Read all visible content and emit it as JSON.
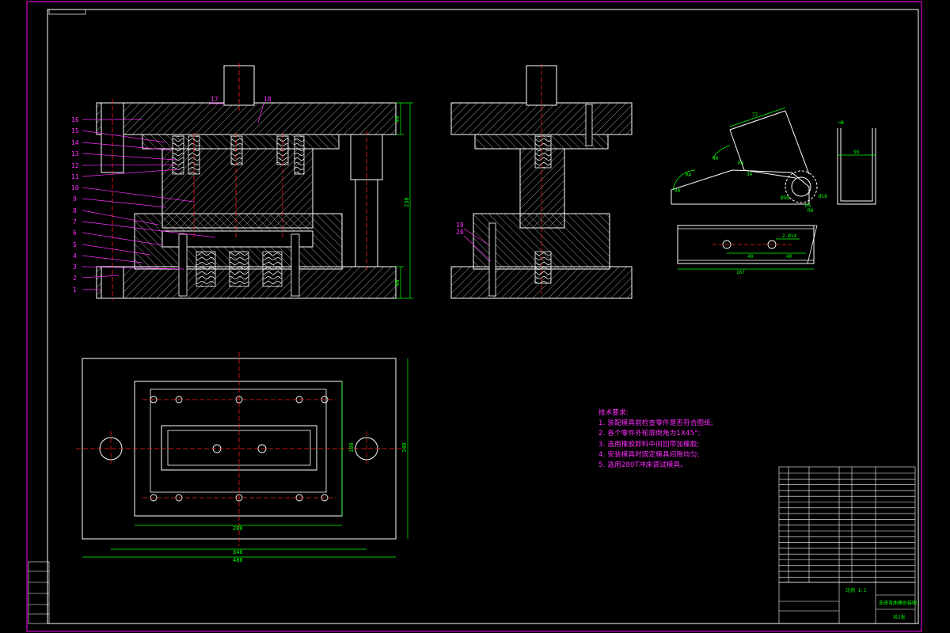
{
  "part_labels_left": [
    "16",
    "15",
    "14",
    "13",
    "12",
    "11",
    "10",
    "9",
    "8",
    "7",
    "6",
    "5",
    "4",
    "3",
    "2",
    "1"
  ],
  "top_labels": [
    "17",
    "18"
  ],
  "side_labels": [
    "19",
    "20"
  ],
  "dims_front": {
    "top": "40",
    "total": "238",
    "bottom": "40"
  },
  "dims_part": {
    "d1": "77",
    "d2": "40",
    "d3": "R4",
    "d4": "90",
    "d5": "34",
    "d6": "R4",
    "d7": "Ø18",
    "d8": "Ø50",
    "d9": "R5",
    "d10": "R8"
  },
  "dims_u": {
    "top": "R",
    "inner": "56"
  },
  "dims_flat": {
    "hole": "2-Ø14",
    "a": "40",
    "b": "40",
    "len": "167"
  },
  "dims_plan": {
    "w1": "280",
    "w2": "340",
    "w3": "480",
    "h1": "180",
    "h2": "340"
  },
  "tech_notes": {
    "title": "技术要求:",
    "lines": [
      "1. 装配模具前检查零件是否符合图纸;",
      "2. 各个零件外轮廓倒角为1X45°;",
      "3. 选用橡胶卸料中间回带加橡胶;",
      "4. 安装模具时固定模具间隙均匀;",
      "5. 选用280T冲床调试模具。"
    ]
  },
  "title_block": {
    "scale_text": "比例  1:1",
    "drawing_name": "支座弯曲模总装图",
    "sheet": "共1张"
  },
  "colors": {
    "frame": "#ff00ff",
    "outline": "#ffffff",
    "dim": "#00ff00",
    "center": "#ff2020",
    "yellow": "#ffff00",
    "hatch": "#ffffff"
  }
}
